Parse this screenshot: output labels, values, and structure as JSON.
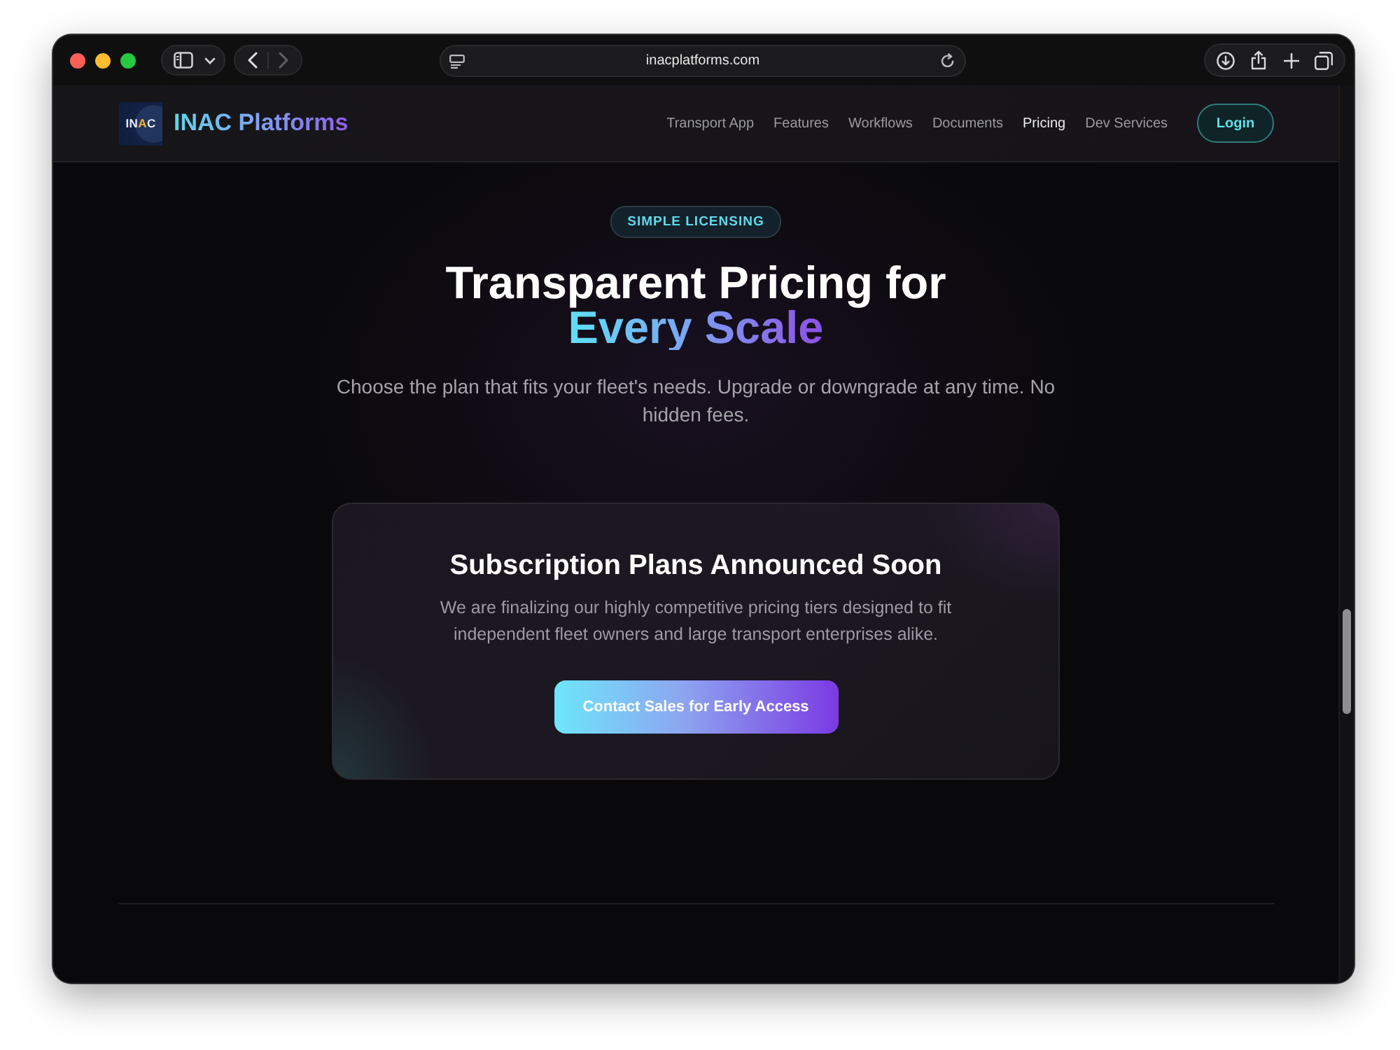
{
  "browser": {
    "url": "inacplatforms.com",
    "back_disabled": false,
    "forward_disabled": true
  },
  "navbar": {
    "logo_mark": [
      {
        "text": "IN",
        "accent": false
      },
      {
        "text": "A",
        "accent": true
      },
      {
        "text": "C",
        "accent": false
      }
    ],
    "brand": "INAC Platforms",
    "links": [
      {
        "label": "Transport App",
        "selected": false
      },
      {
        "label": "Features",
        "selected": false
      },
      {
        "label": "Workflows",
        "selected": false
      },
      {
        "label": "Documents",
        "selected": false
      },
      {
        "label": "Pricing",
        "selected": true
      },
      {
        "label": "Dev Services",
        "selected": false
      }
    ],
    "login": "Login"
  },
  "hero": {
    "badge": "SIMPLE LICENSING",
    "title": "Transparent Pricing for",
    "title_highlight": "Every Scale",
    "subtitle": "Choose the plan that fits your fleet's needs. Upgrade or downgrade at any time. No hidden fees."
  },
  "card": {
    "title": "Subscription Plans Announced Soon",
    "text": "We are finalizing our highly competitive pricing tiers designed to fit independent fleet owners and large transport enterprises alike.",
    "button": "Contact Sales for Early Access"
  }
}
